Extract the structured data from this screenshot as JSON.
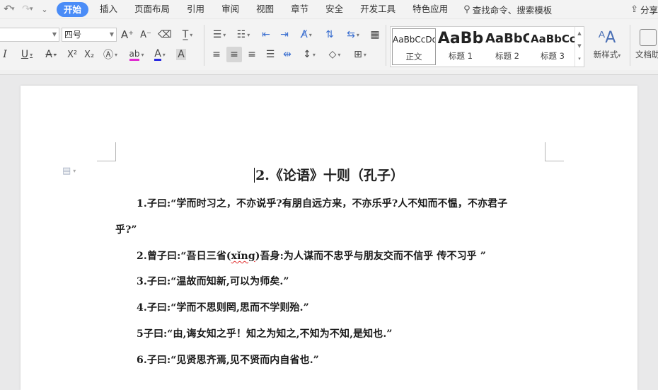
{
  "menubar": {
    "tabs": [
      "开始",
      "插入",
      "页面布局",
      "引用",
      "审阅",
      "视图",
      "章节",
      "安全",
      "开发工具",
      "特色应用"
    ],
    "active_tab": "开始",
    "search_label": "查找命令、搜索模板",
    "share_label": "分享"
  },
  "ribbon": {
    "font_size_value": "四号",
    "styles": [
      {
        "sample": "AaBbCcDd",
        "label": "正文"
      },
      {
        "sample": "AaBb",
        "label": "标题 1"
      },
      {
        "sample": "AaBbC",
        "label": "标题 2"
      },
      {
        "sample": "AaBbCcI",
        "label": "标题 3"
      }
    ],
    "new_style_label": "新样式",
    "doc_assist_label": "文档助"
  },
  "document": {
    "title": "2.《论语》十则（孔子）",
    "paragraphs": [
      {
        "line1": "1.子曰:“学而时习之，不亦说乎?有朋自远方来，不亦乐乎?人不知而不愠，不亦君子",
        "line2": "乎?”"
      },
      {
        "pre": "2.曾子曰:“吾日三省(",
        "pinyin": "xǐng",
        "post": ")吾身:为人谋而不忠乎与朋友交而不信乎  传不习乎  ”"
      },
      {
        "text": "3.子曰:“温故而知新,可以为师矣.”"
      },
      {
        "text": "4.子曰:“学而不思则罔,思而不学则殆.”"
      },
      {
        "text": "5子曰:“由,诲女知之乎！知之为知之,不知为不知,是知也.”"
      },
      {
        "text": "6.子曰:“见贤思齐焉,见不贤而内自省也.”"
      }
    ]
  }
}
